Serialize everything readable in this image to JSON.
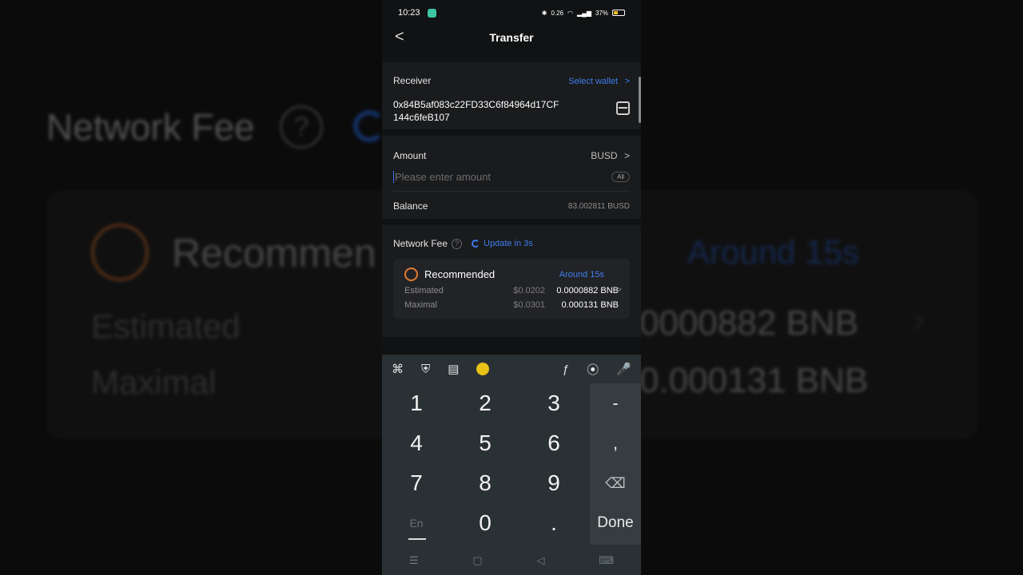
{
  "background": {
    "network_fee": "Network Fee",
    "help_glyph": "?",
    "recommended": "Recommen",
    "around": "Around 15s",
    "estimated": "Estimated",
    "maximal": "Maximal",
    "estimated_value": "0000882 BNB",
    "maximal_value": "0.000131 BNB"
  },
  "status_bar": {
    "time": "10:23",
    "net_speed": "0.26",
    "battery": "37%"
  },
  "header": {
    "title": "Transfer",
    "back_glyph": "<"
  },
  "receiver": {
    "label": "Receiver",
    "select_wallet": "Select wallet",
    "chevron": ">",
    "address_line1": "0x84B5af083c22FD33C6f84964d17CF",
    "address_line2": "144c6feB107"
  },
  "amount": {
    "label": "Amount",
    "token": "BUSD",
    "chevron": ">",
    "placeholder": "Please enter amount",
    "all_label": "All",
    "balance_label": "Balance",
    "balance_value": "83.002811 BUSD"
  },
  "network_fee": {
    "label": "Network Fee",
    "help": "?",
    "update": "Update in 3s",
    "recommended": "Recommended",
    "around": "Around 15s",
    "estimated_label": "Estimated",
    "estimated_usd": "$0.0202",
    "estimated_bnb": "0.0000882 BNB",
    "maximal_label": "Maximal",
    "maximal_usd": "$0.0301",
    "maximal_bnb": "0.000131 BNB",
    "chevron": ">"
  },
  "keyboard": {
    "tools": [
      "⌘",
      "⛨",
      "▤",
      "ƒ",
      "⦿",
      "🎤"
    ],
    "keys": [
      "1",
      "2",
      "3",
      "4",
      "5",
      "6",
      "7",
      "8",
      "9",
      "0",
      "."
    ],
    "dash": "-",
    "comma": ",",
    "backspace": "⌫",
    "lang": "En",
    "done": "Done"
  },
  "system_nav": {
    "menu": "☰",
    "home": "▢",
    "back": "◁",
    "keyboard": "⌨"
  }
}
